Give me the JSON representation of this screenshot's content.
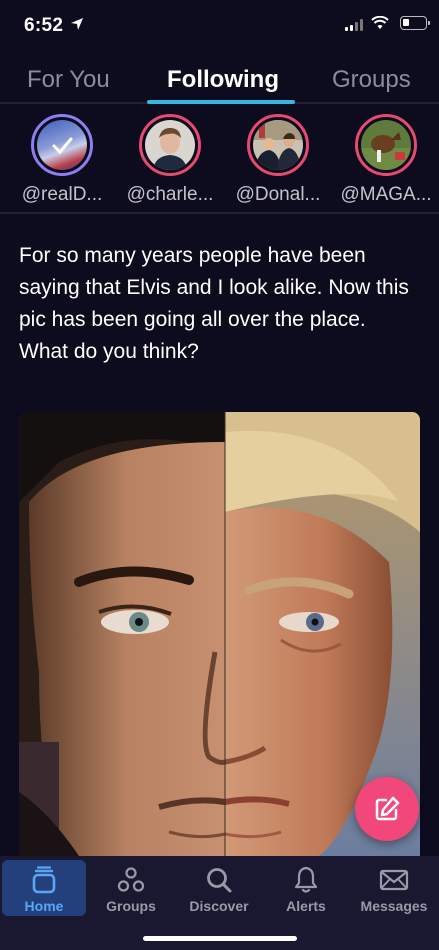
{
  "status_bar": {
    "time": "6:52"
  },
  "tabs": [
    {
      "label": "For You",
      "active": false
    },
    {
      "label": "Following",
      "active": true
    },
    {
      "label": "Groups",
      "active": false
    }
  ],
  "stories": [
    {
      "handle": "@realD..."
    },
    {
      "handle": "@charle..."
    },
    {
      "handle": "@Donal..."
    },
    {
      "handle": "@MAGA..."
    }
  ],
  "post": {
    "text": "For so many years people have been saying that Elvis and I look alike. Now this pic has been going all over the place. What do you think?"
  },
  "bottom_nav": [
    {
      "label": "Home",
      "icon": "home-icon",
      "active": true
    },
    {
      "label": "Groups",
      "icon": "groups-icon",
      "active": false
    },
    {
      "label": "Discover",
      "icon": "search-icon",
      "active": false
    },
    {
      "label": "Alerts",
      "icon": "bell-icon",
      "active": false
    },
    {
      "label": "Messages",
      "icon": "envelope-icon",
      "active": false
    }
  ],
  "colors": {
    "background": "#0d0b1e",
    "accent": "#36b6e0",
    "fab": "#f2477a",
    "ring": "#e84a6f",
    "nav_active": "#5aa6f5"
  }
}
